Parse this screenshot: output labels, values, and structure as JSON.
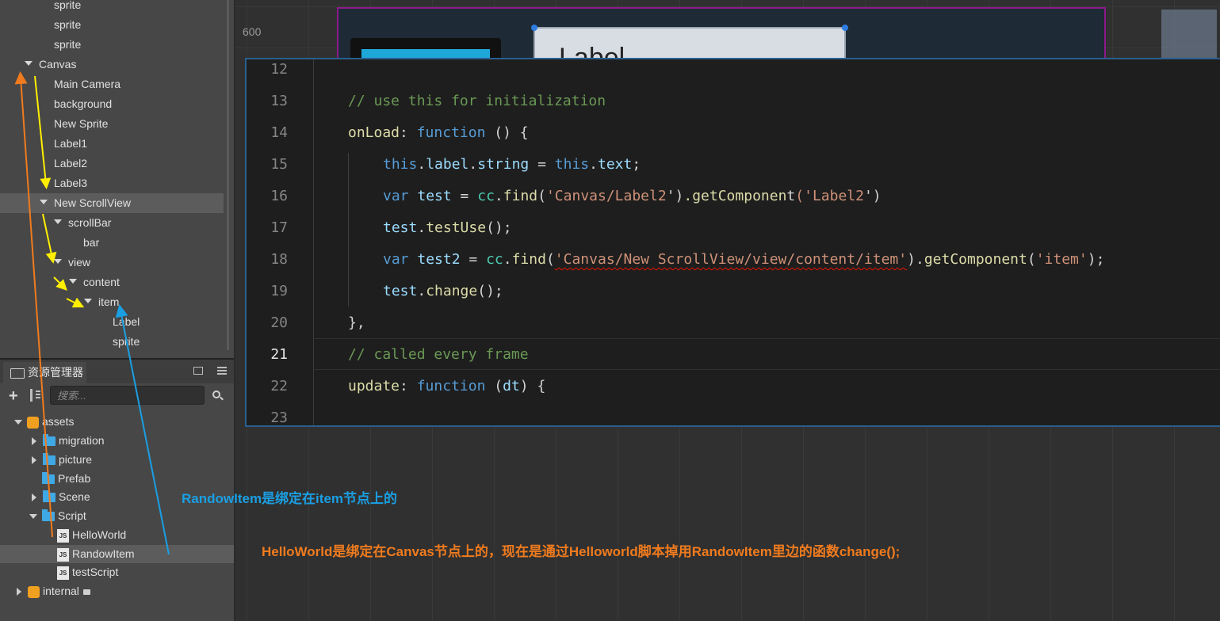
{
  "hierarchy": {
    "nodes": [
      {
        "label": "sprite",
        "expanded": false
      },
      {
        "label": "sprite",
        "expanded": false
      },
      {
        "label": "sprite",
        "expanded": false
      },
      {
        "label": "Canvas",
        "expanded": true
      },
      {
        "label": "Main Camera",
        "expanded": false
      },
      {
        "label": "background",
        "expanded": false
      },
      {
        "label": "New Sprite",
        "expanded": false
      },
      {
        "label": "Label1",
        "expanded": false
      },
      {
        "label": "Label2",
        "expanded": false
      },
      {
        "label": "Label3",
        "expanded": false
      },
      {
        "label": "New ScrollView",
        "expanded": true,
        "selected": true
      },
      {
        "label": "scrollBar",
        "expanded": true
      },
      {
        "label": "bar",
        "expanded": false
      },
      {
        "label": "view",
        "expanded": true
      },
      {
        "label": "content",
        "expanded": true
      },
      {
        "label": "item",
        "expanded": true
      },
      {
        "label": "Label",
        "expanded": false
      },
      {
        "label": "sprite",
        "expanded": false
      }
    ]
  },
  "assets_panel": {
    "title": "资源管理器",
    "search_placeholder": "搜索...",
    "items": [
      {
        "label": "assets",
        "icon": "database-icon"
      },
      {
        "label": "migration",
        "icon": "folder-icon"
      },
      {
        "label": "picture",
        "icon": "folder-icon"
      },
      {
        "label": "Prefab",
        "icon": "folder-icon"
      },
      {
        "label": "Scene",
        "icon": "folder-icon"
      },
      {
        "label": "Script",
        "icon": "folder-icon"
      },
      {
        "label": "HelloWorld",
        "icon": "js-file-icon"
      },
      {
        "label": "RandowItem",
        "icon": "js-file-icon",
        "selected": true
      },
      {
        "label": "testScript",
        "icon": "js-file-icon"
      },
      {
        "label": "internal",
        "icon": "database-icon",
        "locked": true
      }
    ]
  },
  "scene": {
    "ruler_value": "600",
    "preview_label": "Label"
  },
  "editor": {
    "current_line": "21",
    "lines": [
      {
        "num": "12",
        "text": ""
      },
      {
        "num": "13",
        "text": "// use this for initialization"
      },
      {
        "num": "14",
        "text": "onLoad: function () {"
      },
      {
        "num": "15",
        "text": "this.label.string = this.text;"
      },
      {
        "num": "16",
        "text": "var test = cc.find('Canvas/Label2').getComponent('Label2');"
      },
      {
        "num": "17",
        "text": "test.testUse();"
      },
      {
        "num": "18",
        "text": "var test2 = cc.find('Canvas/New ScrollView/view/content/item').getComponent('item');"
      },
      {
        "num": "19",
        "text": "test.change();"
      },
      {
        "num": "20",
        "text": "},"
      },
      {
        "num": "21",
        "text": "// called every frame"
      },
      {
        "num": "22",
        "text": "update: function (dt) {"
      },
      {
        "num": "23",
        "text": ""
      }
    ]
  },
  "annotations": {
    "note_blue": "RandowItem是绑定在item节点上的",
    "note_orange": "HelloWorld是绑定在Canvas节点上的，现在是通过Helloworld脚本掉用RandowItem里边的函数change();",
    "colors": {
      "blue": "#1a9fe3",
      "orange": "#f07b1e",
      "yellow": "#ffee00"
    }
  }
}
